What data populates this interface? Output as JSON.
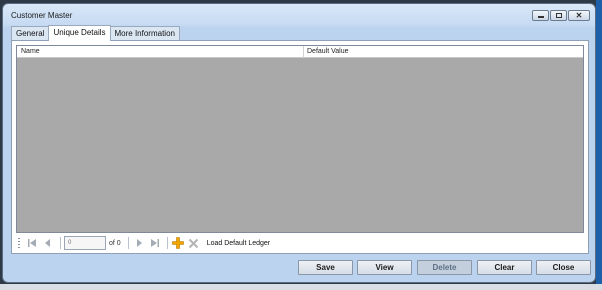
{
  "window": {
    "title": "Customer Master",
    "controls": [
      "minimize-icon",
      "maximize-icon",
      "close-icon"
    ]
  },
  "tabs": [
    {
      "label": "General"
    },
    {
      "label": "Unique Details",
      "active": true
    },
    {
      "label": "More Information"
    }
  ],
  "grid": {
    "columns": [
      "Name",
      "Default Value"
    ],
    "rows": []
  },
  "navigator": {
    "position_value": "0",
    "of_text": "of 0",
    "load_label": "Load Default Ledger",
    "icons": [
      "first-record-icon",
      "prev-record-icon",
      "next-record-icon",
      "last-record-icon",
      "add-icon",
      "delete-icon"
    ]
  },
  "buttons": {
    "save": "Save",
    "view": "View",
    "delete": "Delete",
    "clear": "Clear",
    "close": "Close"
  },
  "colors": {
    "grid_background": "#a9a9a9",
    "window_frame": "#bcd3ef",
    "add_icon": "#f0a500",
    "delete_icon": "#b5b5b5"
  }
}
